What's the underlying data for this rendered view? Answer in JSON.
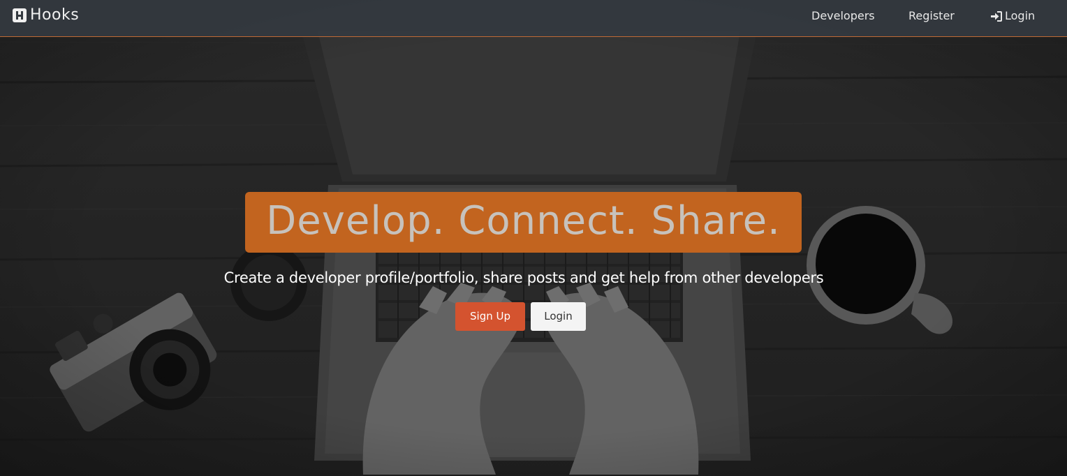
{
  "navbar": {
    "brand": "Hooks",
    "brand_icon": "h-logo-icon",
    "links": [
      {
        "label": "Developers"
      },
      {
        "label": "Register"
      },
      {
        "label": "Login",
        "icon": "sign-in-icon"
      }
    ]
  },
  "hero": {
    "headline": "Develop. Connect. Share.",
    "tagline": "Create a developer profile/portfolio, share posts and get help from other developers",
    "buttons": {
      "signup": "Sign Up",
      "login": "Login"
    }
  },
  "colors": {
    "accent": "#d4532f",
    "headline_bg": "#c2641f",
    "navbar_bg": "#343a40",
    "navbar_border": "#c06a35"
  }
}
